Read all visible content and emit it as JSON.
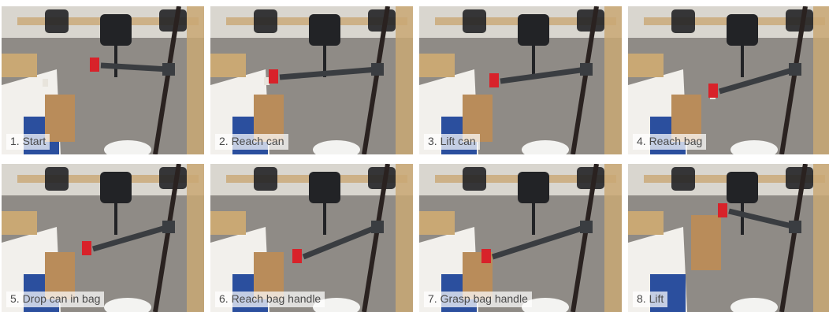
{
  "panels": [
    {
      "caption": "1. Start"
    },
    {
      "caption": "2. Reach can"
    },
    {
      "caption": "3. Lift can"
    },
    {
      "caption": "4. Reach bag"
    },
    {
      "caption": "5. Drop can in bag"
    },
    {
      "caption": "6. Reach bag handle"
    },
    {
      "caption": "7. Grasp bag handle"
    },
    {
      "caption": "8. Lift"
    }
  ],
  "colors": {
    "floor": "#8f8b86",
    "wall": "#d9d6cf",
    "desk": "#c9a874",
    "cabinet": "#f2f0ec",
    "bin": "#2b4f9e",
    "paper_bag": "#b98c5a",
    "robot_arm": "#3a3d41",
    "gripper": "#d8222a",
    "chair": "#222326",
    "pole": "#2a2220"
  }
}
